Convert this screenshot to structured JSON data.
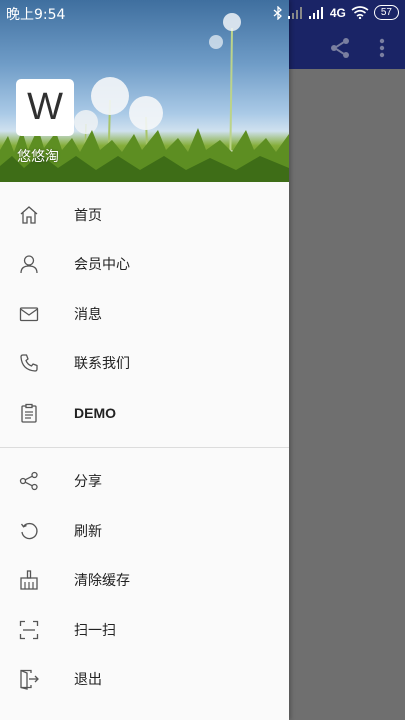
{
  "status_bar": {
    "time": "晚上9:54",
    "network": "4G",
    "battery": "57"
  },
  "drawer": {
    "avatar_letter": "W",
    "username": "悠悠淘",
    "menu_primary": [
      {
        "label": "首页",
        "icon": "home-icon"
      },
      {
        "label": "会员中心",
        "icon": "user-icon"
      },
      {
        "label": "消息",
        "icon": "mail-icon"
      },
      {
        "label": "联系我们",
        "icon": "phone-icon"
      },
      {
        "label": "DEMO",
        "icon": "clipboard-icon"
      }
    ],
    "menu_secondary": [
      {
        "label": "分享",
        "icon": "share-icon"
      },
      {
        "label": "刷新",
        "icon": "refresh-icon"
      },
      {
        "label": "清除缓存",
        "icon": "broom-icon"
      },
      {
        "label": "扫一扫",
        "icon": "scan-icon"
      },
      {
        "label": "退出",
        "icon": "exit-icon"
      }
    ]
  },
  "toolbar": {
    "actions": [
      "share-icon",
      "more-vertical-icon"
    ]
  },
  "colors": {
    "toolbar": "#1a2466",
    "scrim": "#6f6f6f",
    "drawer_bg": "#fafafa",
    "text": "#222222",
    "icon": "#555555"
  }
}
